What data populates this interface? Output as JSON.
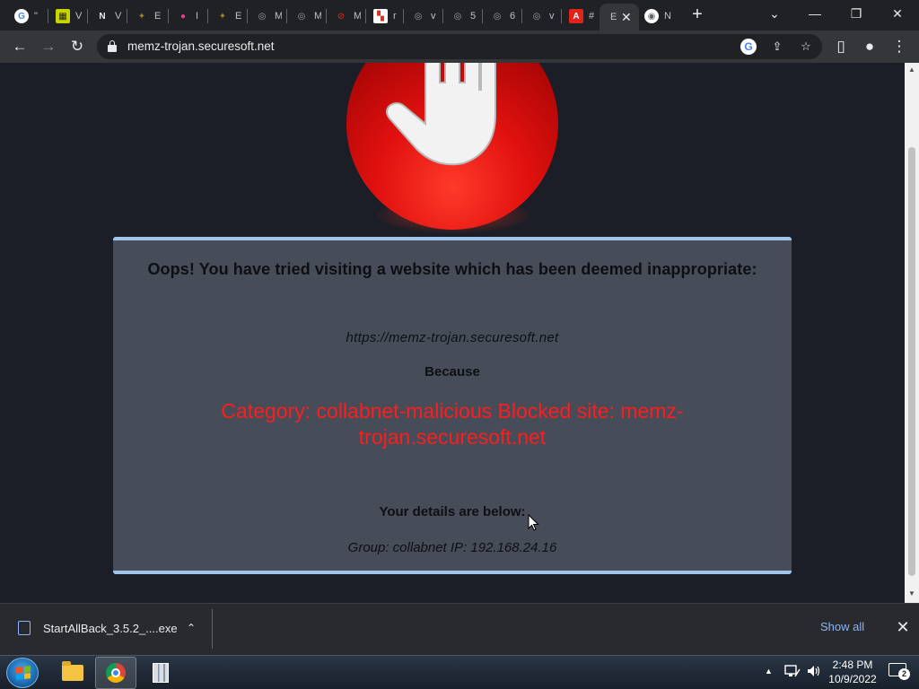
{
  "tabs": [
    {
      "icon": "google-icon",
      "color": "#ffffff",
      "glyph": "G",
      "title": "\""
    },
    {
      "icon": "calculator-icon",
      "color": "#c8d400",
      "glyph": "▦",
      "title": "V"
    },
    {
      "icon": "notion-icon",
      "color": "#e8eaed",
      "glyph": "N",
      "title": "V"
    },
    {
      "icon": "eagle-icon",
      "color": "#a0822d",
      "glyph": "✦",
      "title": "E"
    },
    {
      "icon": "color-wheel-icon",
      "color": "#e53f8a",
      "glyph": "●",
      "title": "I"
    },
    {
      "icon": "eagle-icon",
      "color": "#a0822d",
      "glyph": "✦",
      "title": "E"
    },
    {
      "icon": "globe-icon",
      "color": "#9aa0a6",
      "glyph": "◎",
      "title": "M"
    },
    {
      "icon": "globe-icon",
      "color": "#9aa0a6",
      "glyph": "◎",
      "title": "M"
    },
    {
      "icon": "blocked-site-icon",
      "color": "#b8261d",
      "glyph": "⊘",
      "title": "M"
    },
    {
      "icon": "checker-icon",
      "color": "#d93025",
      "glyph": "▚",
      "title": "r"
    },
    {
      "icon": "globe-icon",
      "color": "#9aa0a6",
      "glyph": "◎",
      "title": "v"
    },
    {
      "icon": "globe-icon",
      "color": "#9aa0a6",
      "glyph": "◎",
      "title": "5"
    },
    {
      "icon": "globe-icon",
      "color": "#9aa0a6",
      "glyph": "◎",
      "title": "6"
    },
    {
      "icon": "globe-icon",
      "color": "#9aa0a6",
      "glyph": "◎",
      "title": "v"
    },
    {
      "icon": "adobe-icon",
      "color": "#e0231b",
      "glyph": "A",
      "title": "#"
    },
    {
      "icon": "blank-icon",
      "color": "#35363a",
      "glyph": "",
      "title": "E",
      "active": true
    },
    {
      "icon": "chrome-icon",
      "color": "#ffffff",
      "glyph": "◉",
      "title": "N"
    }
  ],
  "window_controls": {
    "tab_search": "⌄",
    "minimize": "—",
    "restore": "❐",
    "close": "✕"
  },
  "toolbar": {
    "back": "←",
    "forward": "→",
    "reload": "↻",
    "url": "memz-trojan.securesoft.net",
    "share": "⇪",
    "bookmark": "☆",
    "sidepanel": "▯",
    "profile": "●",
    "menu": "⋮",
    "google_lens": "G"
  },
  "page": {
    "heading": "Oops! You have tried visiting a website which has been deemed inappropriate:",
    "blocked_url": "https://memz-trojan.securesoft.net",
    "because": "Because",
    "category": "Category: collabnet-malicious  Blocked site: memz-trojan.securesoft.net",
    "details_heading": "Your details are below:",
    "group_ip": "Group: collabnet    IP: 192.168.24.16",
    "colors": {
      "panel": "#474c59",
      "accent": "#9fc6ea",
      "warning": "#ff1c1c",
      "stop_sign": "#e0110f"
    }
  },
  "downloads": {
    "filename": "StartAllBack_3.5.2_....exe",
    "chevron": "⌃",
    "show_all": "Show all",
    "close": "✕"
  },
  "taskbar": {
    "apps": [
      "file-explorer",
      "google-chrome",
      "winrar"
    ],
    "clock_time": "2:48 PM",
    "clock_date": "10/9/2022",
    "tray_chevron": "▲",
    "notification_count": "2"
  }
}
